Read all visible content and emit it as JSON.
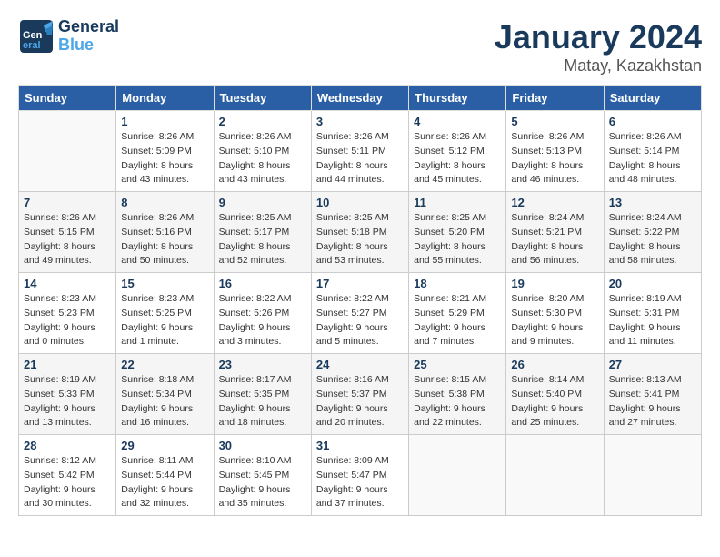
{
  "app": {
    "logo_general": "General",
    "logo_blue": "Blue",
    "month": "January 2024",
    "location": "Matay, Kazakhstan"
  },
  "calendar": {
    "headers": [
      "Sunday",
      "Monday",
      "Tuesday",
      "Wednesday",
      "Thursday",
      "Friday",
      "Saturday"
    ],
    "weeks": [
      [
        {
          "day": "",
          "info": ""
        },
        {
          "day": "1",
          "info": "Sunrise: 8:26 AM\nSunset: 5:09 PM\nDaylight: 8 hours\nand 43 minutes."
        },
        {
          "day": "2",
          "info": "Sunrise: 8:26 AM\nSunset: 5:10 PM\nDaylight: 8 hours\nand 43 minutes."
        },
        {
          "day": "3",
          "info": "Sunrise: 8:26 AM\nSunset: 5:11 PM\nDaylight: 8 hours\nand 44 minutes."
        },
        {
          "day": "4",
          "info": "Sunrise: 8:26 AM\nSunset: 5:12 PM\nDaylight: 8 hours\nand 45 minutes."
        },
        {
          "day": "5",
          "info": "Sunrise: 8:26 AM\nSunset: 5:13 PM\nDaylight: 8 hours\nand 46 minutes."
        },
        {
          "day": "6",
          "info": "Sunrise: 8:26 AM\nSunset: 5:14 PM\nDaylight: 8 hours\nand 48 minutes."
        }
      ],
      [
        {
          "day": "7",
          "info": "Sunrise: 8:26 AM\nSunset: 5:15 PM\nDaylight: 8 hours\nand 49 minutes."
        },
        {
          "day": "8",
          "info": "Sunrise: 8:26 AM\nSunset: 5:16 PM\nDaylight: 8 hours\nand 50 minutes."
        },
        {
          "day": "9",
          "info": "Sunrise: 8:25 AM\nSunset: 5:17 PM\nDaylight: 8 hours\nand 52 minutes."
        },
        {
          "day": "10",
          "info": "Sunrise: 8:25 AM\nSunset: 5:18 PM\nDaylight: 8 hours\nand 53 minutes."
        },
        {
          "day": "11",
          "info": "Sunrise: 8:25 AM\nSunset: 5:20 PM\nDaylight: 8 hours\nand 55 minutes."
        },
        {
          "day": "12",
          "info": "Sunrise: 8:24 AM\nSunset: 5:21 PM\nDaylight: 8 hours\nand 56 minutes."
        },
        {
          "day": "13",
          "info": "Sunrise: 8:24 AM\nSunset: 5:22 PM\nDaylight: 8 hours\nand 58 minutes."
        }
      ],
      [
        {
          "day": "14",
          "info": "Sunrise: 8:23 AM\nSunset: 5:23 PM\nDaylight: 9 hours\nand 0 minutes."
        },
        {
          "day": "15",
          "info": "Sunrise: 8:23 AM\nSunset: 5:25 PM\nDaylight: 9 hours\nand 1 minute."
        },
        {
          "day": "16",
          "info": "Sunrise: 8:22 AM\nSunset: 5:26 PM\nDaylight: 9 hours\nand 3 minutes."
        },
        {
          "day": "17",
          "info": "Sunrise: 8:22 AM\nSunset: 5:27 PM\nDaylight: 9 hours\nand 5 minutes."
        },
        {
          "day": "18",
          "info": "Sunrise: 8:21 AM\nSunset: 5:29 PM\nDaylight: 9 hours\nand 7 minutes."
        },
        {
          "day": "19",
          "info": "Sunrise: 8:20 AM\nSunset: 5:30 PM\nDaylight: 9 hours\nand 9 minutes."
        },
        {
          "day": "20",
          "info": "Sunrise: 8:19 AM\nSunset: 5:31 PM\nDaylight: 9 hours\nand 11 minutes."
        }
      ],
      [
        {
          "day": "21",
          "info": "Sunrise: 8:19 AM\nSunset: 5:33 PM\nDaylight: 9 hours\nand 13 minutes."
        },
        {
          "day": "22",
          "info": "Sunrise: 8:18 AM\nSunset: 5:34 PM\nDaylight: 9 hours\nand 16 minutes."
        },
        {
          "day": "23",
          "info": "Sunrise: 8:17 AM\nSunset: 5:35 PM\nDaylight: 9 hours\nand 18 minutes."
        },
        {
          "day": "24",
          "info": "Sunrise: 8:16 AM\nSunset: 5:37 PM\nDaylight: 9 hours\nand 20 minutes."
        },
        {
          "day": "25",
          "info": "Sunrise: 8:15 AM\nSunset: 5:38 PM\nDaylight: 9 hours\nand 22 minutes."
        },
        {
          "day": "26",
          "info": "Sunrise: 8:14 AM\nSunset: 5:40 PM\nDaylight: 9 hours\nand 25 minutes."
        },
        {
          "day": "27",
          "info": "Sunrise: 8:13 AM\nSunset: 5:41 PM\nDaylight: 9 hours\nand 27 minutes."
        }
      ],
      [
        {
          "day": "28",
          "info": "Sunrise: 8:12 AM\nSunset: 5:42 PM\nDaylight: 9 hours\nand 30 minutes."
        },
        {
          "day": "29",
          "info": "Sunrise: 8:11 AM\nSunset: 5:44 PM\nDaylight: 9 hours\nand 32 minutes."
        },
        {
          "day": "30",
          "info": "Sunrise: 8:10 AM\nSunset: 5:45 PM\nDaylight: 9 hours\nand 35 minutes."
        },
        {
          "day": "31",
          "info": "Sunrise: 8:09 AM\nSunset: 5:47 PM\nDaylight: 9 hours\nand 37 minutes."
        },
        {
          "day": "",
          "info": ""
        },
        {
          "day": "",
          "info": ""
        },
        {
          "day": "",
          "info": ""
        }
      ]
    ]
  }
}
